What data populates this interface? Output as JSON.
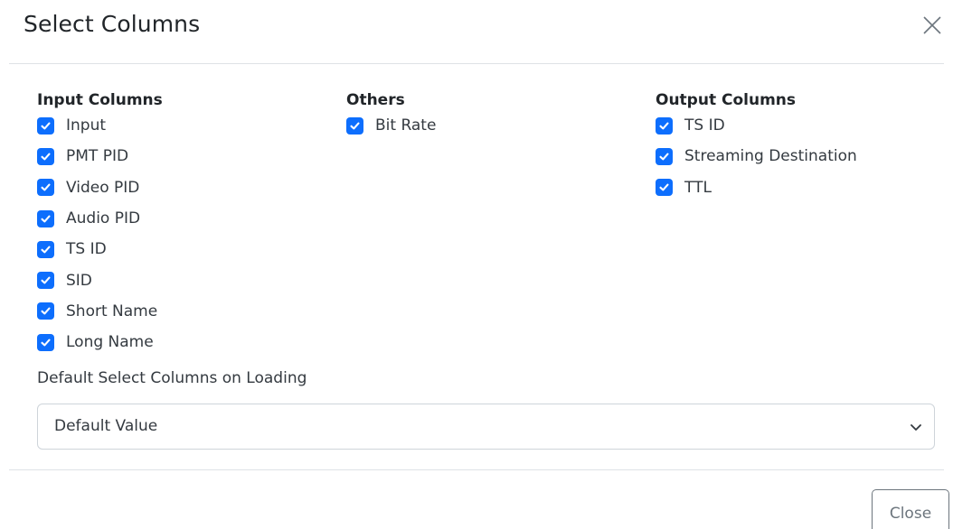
{
  "dialog": {
    "title": "Select Columns",
    "close_icon": "close-icon"
  },
  "input_columns": {
    "heading": "Input Columns",
    "items": [
      {
        "label": "Input",
        "checked": true
      },
      {
        "label": "PMT PID",
        "checked": true
      },
      {
        "label": "Video PID",
        "checked": true
      },
      {
        "label": "Audio PID",
        "checked": true
      },
      {
        "label": "TS ID",
        "checked": true
      },
      {
        "label": "SID",
        "checked": true
      },
      {
        "label": "Short Name",
        "checked": true
      },
      {
        "label": "Long Name",
        "checked": true
      }
    ]
  },
  "others": {
    "heading": "Others",
    "items": [
      {
        "label": "Bit Rate",
        "checked": true
      }
    ]
  },
  "output_columns": {
    "heading": "Output Columns",
    "items": [
      {
        "label": "TS ID",
        "checked": true
      },
      {
        "label": "Streaming Destination",
        "checked": true
      },
      {
        "label": "TTL",
        "checked": true
      }
    ]
  },
  "default_select": {
    "label": "Default Select Columns on Loading",
    "value": "Default Value",
    "icon": "chevron-down-icon"
  },
  "footer": {
    "close_label": "Close"
  },
  "colors": {
    "checkbox": "#0d6efd",
    "divider": "#dee2e6",
    "close_button_border": "#6c757d"
  }
}
